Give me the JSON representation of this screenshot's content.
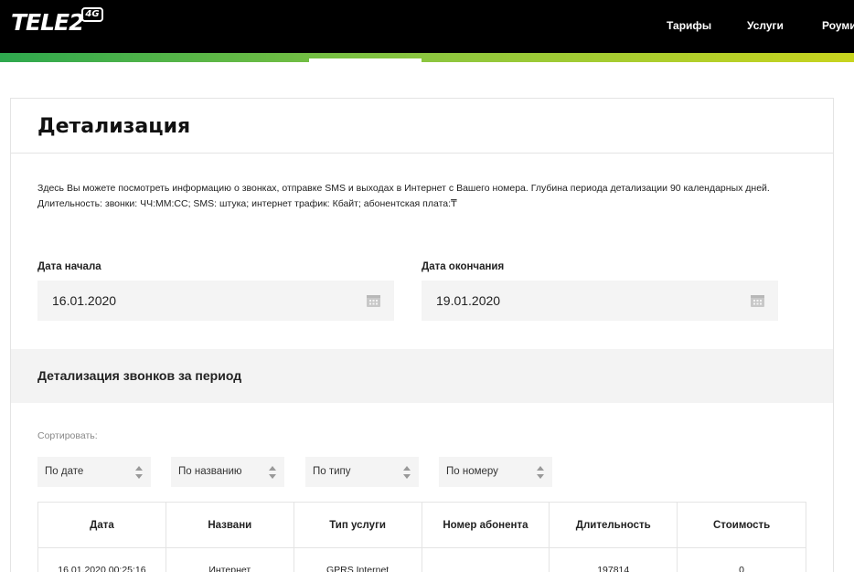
{
  "header": {
    "logo_text": "TELE2",
    "logo_badge": "4G",
    "nav": [
      {
        "label": "Тарифы"
      },
      {
        "label": "Услуги"
      },
      {
        "label": "Роуминг"
      }
    ]
  },
  "page": {
    "title": "Детализация",
    "intro": "Здесь Вы можете посмотреть информацию о звонках, отправке SMS и выходах в Интернет с Вашего номера. Глубина периода детализации 90 календарных дней. Длительность: звонки: ЧЧ:ММ:СС; SMS: штука; интернет трафик: Кбайт; абонентская плата:₸"
  },
  "dates": {
    "start_label": "Дата начала",
    "start_value": "16.01.2020",
    "end_label": "Дата окончания",
    "end_value": "19.01.2020"
  },
  "section": {
    "title": "Детализация звонков за период"
  },
  "sort": {
    "label": "Сортировать:",
    "options": [
      {
        "label": "По дате"
      },
      {
        "label": "По названию"
      },
      {
        "label": "По типу"
      },
      {
        "label": "По номеру"
      }
    ]
  },
  "table": {
    "headers": [
      "Дата",
      "Названи",
      "Тип услуги",
      "Номер абонента",
      "Длительность",
      "Стоимость"
    ],
    "rows": [
      [
        "16.01.2020 00:25:16",
        "Интернет",
        "GPRS Internet",
        "",
        "197814",
        "0"
      ]
    ]
  },
  "colors": {
    "topbar": "#000000",
    "accent_green": "#8cc63f",
    "field_bg": "#f4f4f4"
  }
}
